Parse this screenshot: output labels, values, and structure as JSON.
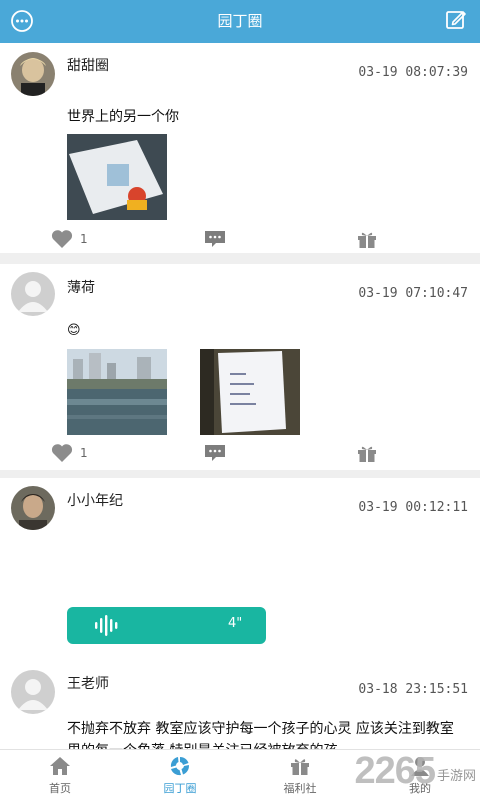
{
  "header": {
    "title": "园丁圈",
    "bg_color": "#4aa8d8"
  },
  "posts": [
    {
      "author": "甜甜圈",
      "time": "03-19 08:07:39",
      "text": "世界上的另一个你",
      "likes": "1"
    },
    {
      "author": "薄荷",
      "time": "03-19 07:10:47",
      "text": "😊",
      "likes": "1"
    },
    {
      "author": "小小年纪",
      "time": "03-19 00:12:11",
      "voice_duration": "4\"",
      "voice_color": "#19b6a1"
    },
    {
      "author": "王老师",
      "time": "03-18 23:15:51",
      "text": "不抛弃不放弃 教室应该守护每一个孩子的心灵 应该关注到教室里的每一个角落 特别是关注已经被放弃的孩"
    }
  ],
  "tabs": [
    {
      "label": "首页",
      "icon": "home-icon"
    },
    {
      "label": "园丁圈",
      "icon": "circle-feed-icon"
    },
    {
      "label": "福利社",
      "icon": "gift-icon"
    },
    {
      "label": "我的",
      "icon": "user-icon"
    }
  ],
  "active_tab": "园丁圈",
  "watermark": {
    "number": "2265",
    "text": "手游网"
  }
}
